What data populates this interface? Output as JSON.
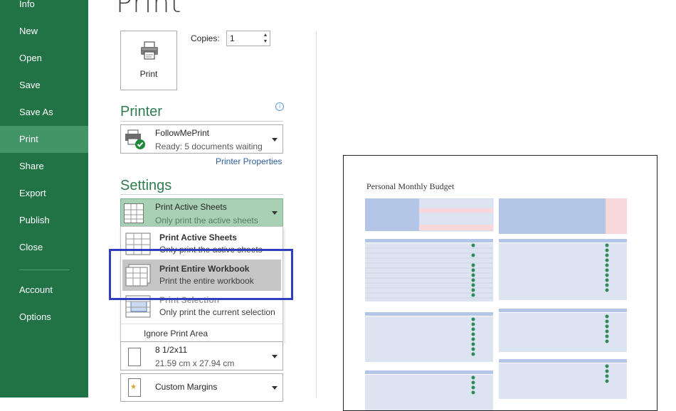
{
  "nav": {
    "items": [
      {
        "label": "Info"
      },
      {
        "label": "New"
      },
      {
        "label": "Open"
      },
      {
        "label": "Save"
      },
      {
        "label": "Save As"
      },
      {
        "label": "Print"
      },
      {
        "label": "Share"
      },
      {
        "label": "Export"
      },
      {
        "label": "Publish"
      },
      {
        "label": "Close"
      },
      {
        "label": "Account"
      },
      {
        "label": "Options"
      }
    ],
    "active": "Print"
  },
  "page": {
    "title": "Print"
  },
  "print_button": {
    "label": "Print",
    "icon": "printer-icon"
  },
  "copies": {
    "label": "Copies:",
    "value": "1"
  },
  "printer": {
    "section_title": "Printer",
    "name": "FollowMePrint",
    "status": "Ready: 5 documents waiting",
    "properties_link": "Printer Properties"
  },
  "settings": {
    "section_title": "Settings",
    "selected": {
      "main": "Print Active Sheets",
      "sub": "Only print the active sheets"
    },
    "options": [
      {
        "main": "Print Active Sheets",
        "sub": "Only print the active sheets"
      },
      {
        "main": "Print Entire Workbook",
        "sub": "Print the entire workbook"
      },
      {
        "main": "Print Selection",
        "sub": "Only print the current selection"
      }
    ],
    "ignore_print_area": "Ignore Print Area",
    "paper": {
      "main": "8 1/2x11",
      "sub": "21.59 cm x 27.94 cm"
    },
    "margins": {
      "main": "Custom Margins"
    }
  },
  "preview": {
    "title": "Personal Monthly Budget"
  },
  "colors": {
    "nav_bg": "#217346",
    "nav_active": "#439467",
    "accent_green": "#2e7d4f",
    "selected_dd": "#a8d0b4",
    "highlight_box": "#2f3fbf",
    "table_header_blue": "#b4c6e7",
    "table_pink": "#f8d7da"
  }
}
